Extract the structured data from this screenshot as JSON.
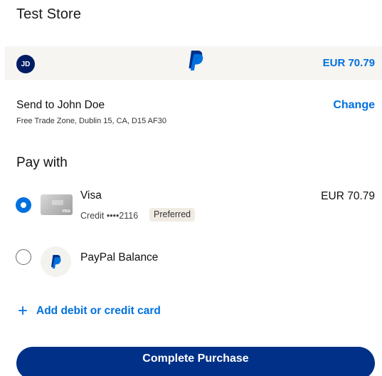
{
  "store": {
    "title": "Test Store"
  },
  "summary": {
    "avatar_initials": "JD",
    "logo_icon": "paypal-logo-icon",
    "amount": "EUR 70.79"
  },
  "shipping": {
    "label": "Send to John Doe",
    "address": "Free Trade Zone, Dublin 15, CA, D15 AF30",
    "change_label": "Change"
  },
  "payment": {
    "heading": "Pay with",
    "methods": [
      {
        "name": "Visa",
        "detail": "Credit ••••2116",
        "badge": "Preferred",
        "amount": "EUR 70.79",
        "selected": true,
        "icon": "visa-card-icon"
      },
      {
        "name": "PayPal Balance",
        "selected": false,
        "icon": "paypal-balance-icon"
      }
    ],
    "add_card_label": "Add debit or credit card",
    "add_icon": "plus-icon"
  },
  "actions": {
    "complete_label": "Complete Purchase"
  },
  "colors": {
    "accent_blue": "#0070e0",
    "navy": "#003087",
    "summary_bg": "#f6f5f2"
  }
}
